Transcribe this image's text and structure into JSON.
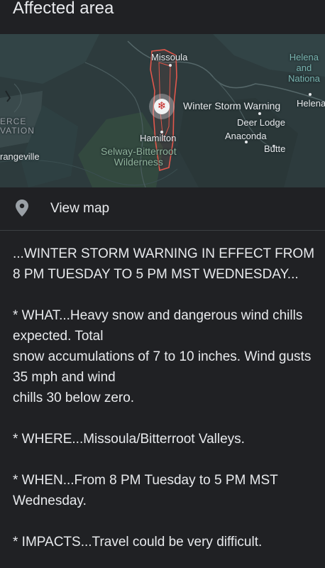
{
  "header": {
    "title": "Affected area"
  },
  "map": {
    "labels": {
      "missoula": "Missoula",
      "helena_nf": "Helena\nand\nNationa",
      "helena": "Helena",
      "winter_storm": "Winter Storm Warning",
      "deer_lodge": "Deer Lodge",
      "anaconda": "Anaconda",
      "butte": "Butte",
      "hamilton": "Hamilton",
      "wilderness": "Selway-Bitterroot\nWilderness",
      "nez_perce": "ERCE\nVATION",
      "grangeville": "rangeville"
    },
    "colors": {
      "polygon": "#e2574c",
      "marker": "#c5221f"
    }
  },
  "view_map": {
    "label": "View map",
    "icon": "location-pin-icon"
  },
  "alert": {
    "headline": "...WINTER STORM WARNING IN EFFECT FROM 8 PM TUESDAY TO 5 PM MST WEDNESDAY...",
    "what_line1": "* WHAT...Heavy snow and dangerous wind chills expected. Total",
    "what_line2": "snow accumulations of 7 to 10 inches. Wind gusts 35 mph and wind",
    "what_line3": "chills 30 below zero.",
    "where": "* WHERE...Missoula/Bitterroot Valleys.",
    "when": "* WHEN...From 8 PM Tuesday to 5 PM MST Wednesday.",
    "impacts": "* IMPACTS...Travel could be very difficult."
  }
}
